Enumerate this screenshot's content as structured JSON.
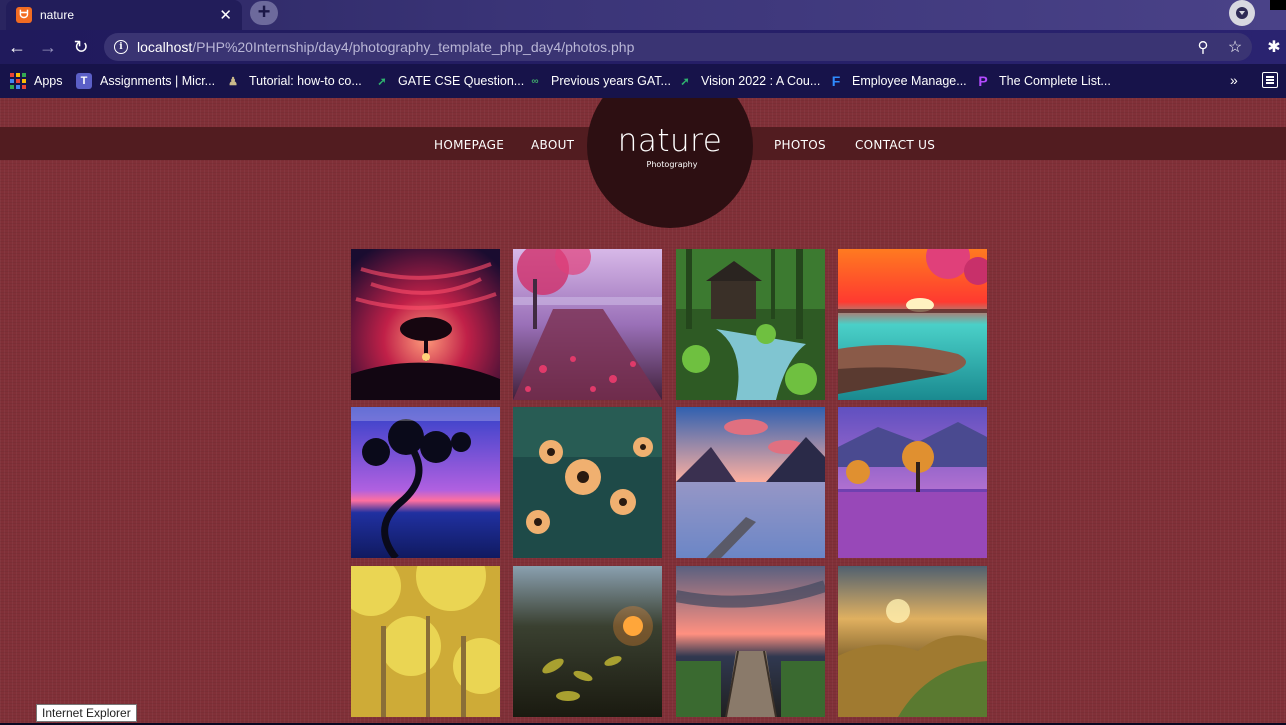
{
  "browser": {
    "tab": {
      "title": "nature",
      "favicon": "xampp-icon"
    },
    "address": {
      "host": "localhost",
      "path": "/PHP%20Internship/day4/photography_template_php_day4/photos.php"
    },
    "bookmarks": [
      {
        "label": "Apps",
        "icon": "apps-grid-icon"
      },
      {
        "label": "Assignments | Micr...",
        "icon": "teams-icon"
      },
      {
        "label": "Tutorial: how-to co...",
        "icon": "tutorial-icon"
      },
      {
        "label": "GATE CSE Question...",
        "icon": "rocket-icon"
      },
      {
        "label": "Previous years GAT...",
        "icon": "gg-icon"
      },
      {
        "label": "Vision 2022 : A Cou...",
        "icon": "rocket-icon"
      },
      {
        "label": "Employee Manage...",
        "icon": "f-icon"
      },
      {
        "label": "The Complete List...",
        "icon": "p-icon"
      }
    ],
    "more_label": "»"
  },
  "site": {
    "logo": {
      "title": "nature",
      "subtitle": "Photography"
    },
    "nav": [
      {
        "label": "HOMEPAGE"
      },
      {
        "label": "ABOUT"
      },
      {
        "label": "PHOTOS"
      },
      {
        "label": "CONTACT US"
      }
    ],
    "photos": [
      {
        "subject": "tree-silhouette-red-sky"
      },
      {
        "subject": "blossom-lake-pier"
      },
      {
        "subject": "forest-waterfall-mill"
      },
      {
        "subject": "sunset-sea-cherry-blossom"
      },
      {
        "subject": "twisted-tree-blue-sea"
      },
      {
        "subject": "daisy-flowers-closeup"
      },
      {
        "subject": "mountain-lake-jetty"
      },
      {
        "subject": "lone-tree-purple-lake"
      },
      {
        "subject": "autumn-forest-canopy"
      },
      {
        "subject": "leaves-sunset-bokeh"
      },
      {
        "subject": "wooden-boardwalk-dusk"
      },
      {
        "subject": "golden-hills-sunrise"
      }
    ]
  },
  "statusbar": {
    "tooltip": "Internet Explorer"
  },
  "colors": {
    "page_background": "#813038",
    "navbar": "#521c20",
    "logo_circle": "#2d0f12",
    "browser_frame": "#1b1747"
  }
}
